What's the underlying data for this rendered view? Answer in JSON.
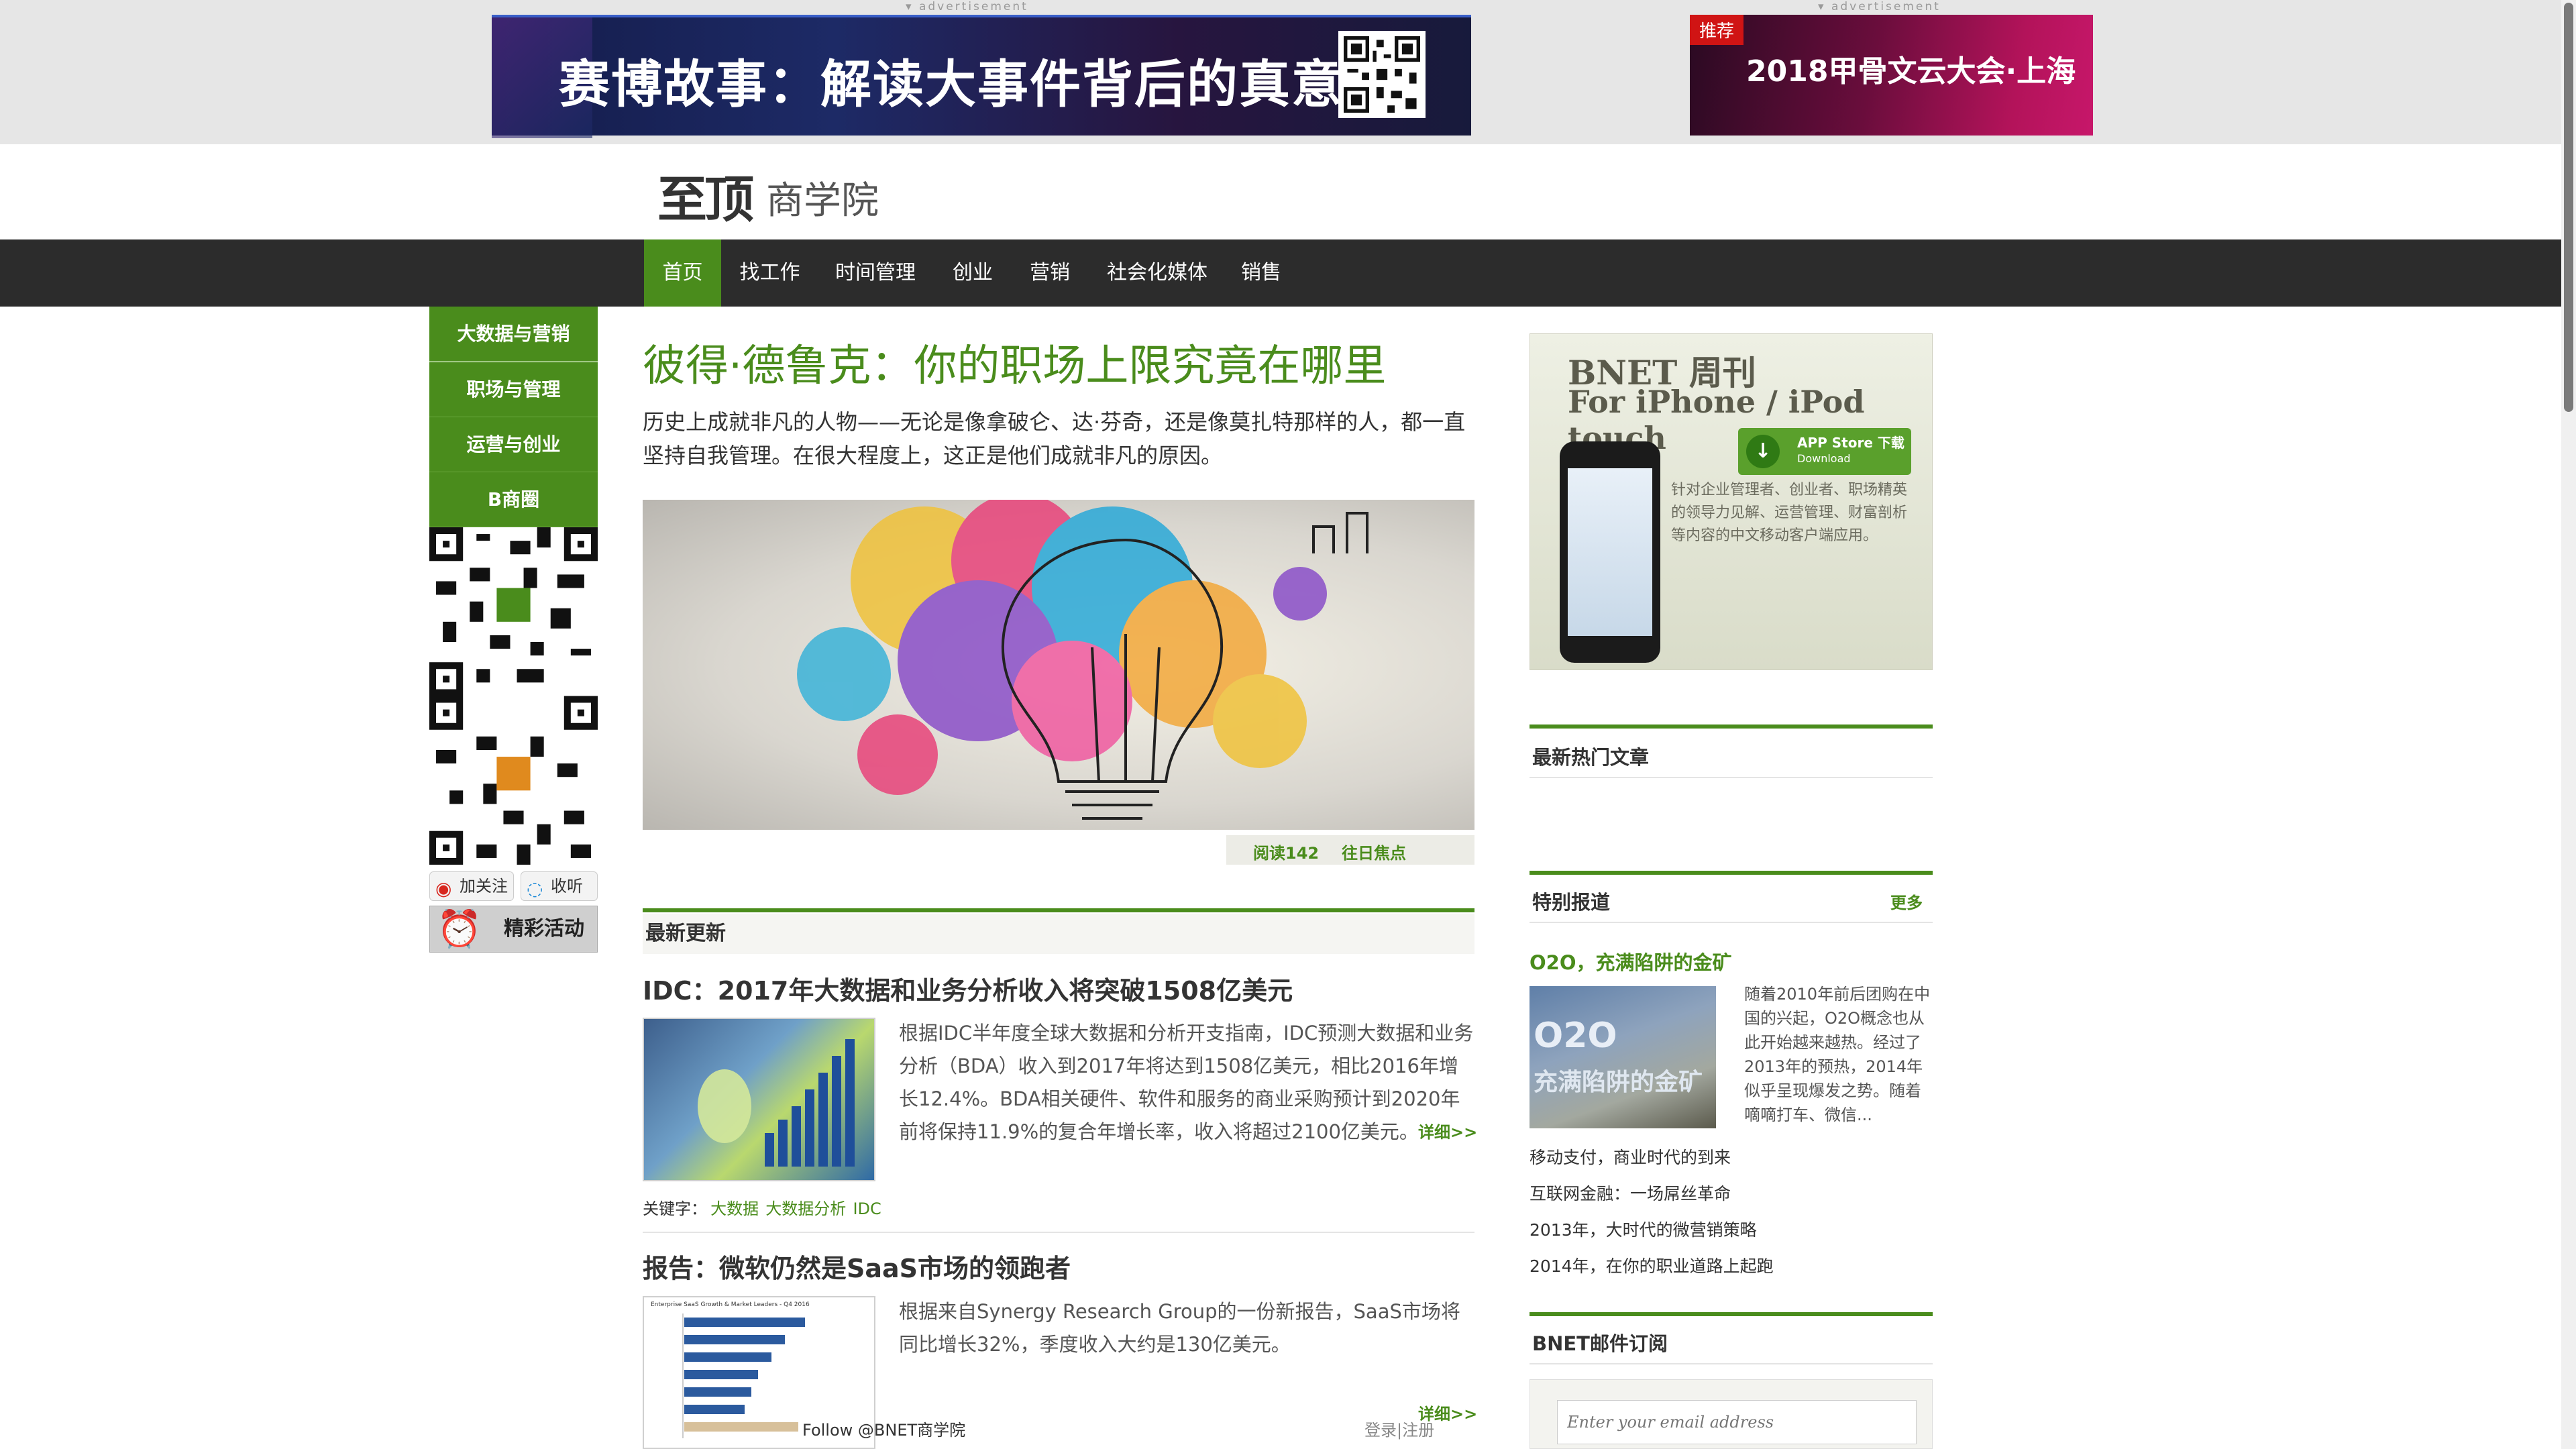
{
  "ads": {
    "tag": "advertisement",
    "ad1_text": "赛博故事：解读大事件背后的真意义",
    "ad2_badge": "推荐",
    "ad2_text": "2018甲骨文云大会·上海"
  },
  "logo": {
    "main": "至顶",
    "sub": "商学院"
  },
  "nav": {
    "items": [
      {
        "label": "首页",
        "active": true
      },
      {
        "label": "找工作"
      },
      {
        "label": "时间管理"
      },
      {
        "label": "创业"
      },
      {
        "label": "营销"
      },
      {
        "label": "社会化媒体"
      },
      {
        "label": "销售"
      }
    ]
  },
  "sidebar": {
    "items": [
      {
        "label": "大数据与营销"
      },
      {
        "label": "职场与管理"
      },
      {
        "label": "运营与创业"
      },
      {
        "label": "B商圈"
      }
    ],
    "follow_weibo": "加关注",
    "follow_listen": "收听",
    "event_banner": "精彩活动"
  },
  "hero": {
    "title": "彼得·德鲁克：你的职场上限究竟在哪里",
    "description": "历史上成就非凡的人物——无论是像拿破仑、达·芬奇，还是像莫扎特那样的人，都一直坚持自我管理。在很大程度上，这正是他们成就非凡的原因。",
    "reads": "阅读142",
    "past_focus": "往日焦点"
  },
  "latest": {
    "heading": "最新更新",
    "articles": [
      {
        "title": "IDC：2017年大数据和业务分析收入将突破1508亿美元",
        "body": "根据IDC半年度全球大数据和分析开支指南，IDC预测大数据和业务分析（BDA）收入到2017年将达到1508亿美元，相比2016年增长12.4%。BDA相关硬件、软件和服务的商业采购预计到2020年前将保持11.9%的复合年增长率，收入将超过2100亿美元。",
        "more": "详细>>",
        "keywords_label": "关键字：",
        "keywords": [
          "大数据",
          "大数据分析",
          "IDC"
        ]
      },
      {
        "title": "报告：微软仍然是SaaS市场的领跑者",
        "body": "根据来自Synergy Research Group的一份新报告，SaaS市场将同比增长32%，季度收入大约是130亿美元。",
        "more": "详细>>",
        "chart_caption": "Enterprise SaaS Growth & Market Leaders - Q4 2016"
      }
    ]
  },
  "footer_bar": {
    "follow": "Follow @BNET商学院",
    "login": "登录",
    "register": "注册"
  },
  "right": {
    "bnet_ad": {
      "title1": "BNET 周刊",
      "title2": "For iPhone / iPod touch",
      "store_label": "APP Store 下载",
      "store_sub": "Download",
      "desc": "针对企业管理者、创业者、职场精英的领导力见解、运营管理、财富剖析等内容的中文移动客户端应用。"
    },
    "hot_heading": "最新热门文章",
    "special_heading": "特别报道",
    "special_more": "更多",
    "o2o_title": "O2O，充满陷阱的金矿",
    "o2o_img_line1": "O2O",
    "o2o_img_line2": "充满陷阱的金矿",
    "o2o_desc": "随着2010年前后团购在中国的兴起，O2O概念也从此开始越来越热。经过了2013年的预热，2014年似乎呈现爆发之势。随着嘀嘀打车、微信...",
    "links": [
      "移动支付，商业时代的到来",
      "互联网金融：一场屌丝革命",
      "2013年，大时代的微营销策略",
      "2014年，在你的职业道路上起跑"
    ],
    "newsletter_heading": "BNET邮件订阅",
    "email_placeholder": "Enter your email address"
  },
  "colors": {
    "brand_green": "#4a8c1c",
    "nav_bg": "#2c2c2c",
    "ad_band": "#e6e6e6"
  }
}
